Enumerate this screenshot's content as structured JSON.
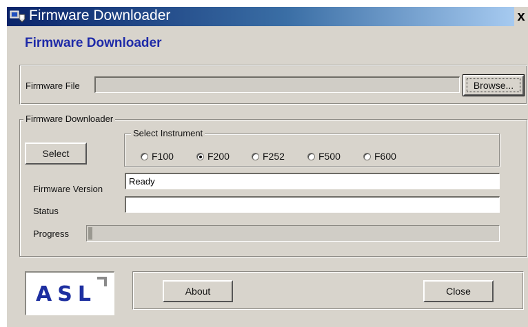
{
  "window": {
    "title": "Firmware Downloader",
    "close_glyph": "x",
    "icon": "app-download-icon"
  },
  "app": {
    "heading": "Firmware Downloader"
  },
  "file_section": {
    "label": "Firmware File",
    "file_value": "",
    "browse_label": "Browse..."
  },
  "downloader_group": {
    "legend": "Firmware Downloader",
    "select_label": "Select",
    "instrument_group": {
      "legend": "Select Instrument",
      "options": [
        "F100",
        "F200",
        "F252",
        "F500",
        "F600"
      ],
      "selected": "F200"
    },
    "version_label": "Firmware Version",
    "version_value": "Ready",
    "status_label": "Status",
    "status_value": "",
    "progress_label": "Progress",
    "progress_value": 0.01
  },
  "footer": {
    "logo_text": "ASL",
    "about_label": "About",
    "close_label": "Close"
  },
  "colors": {
    "title_gradient_start": "#0a246a",
    "title_gradient_end": "#a6caf0",
    "heading_blue": "#1e2aa8",
    "window_bg": "#d8d4cc",
    "logo_blue": "#1d2fa0"
  }
}
